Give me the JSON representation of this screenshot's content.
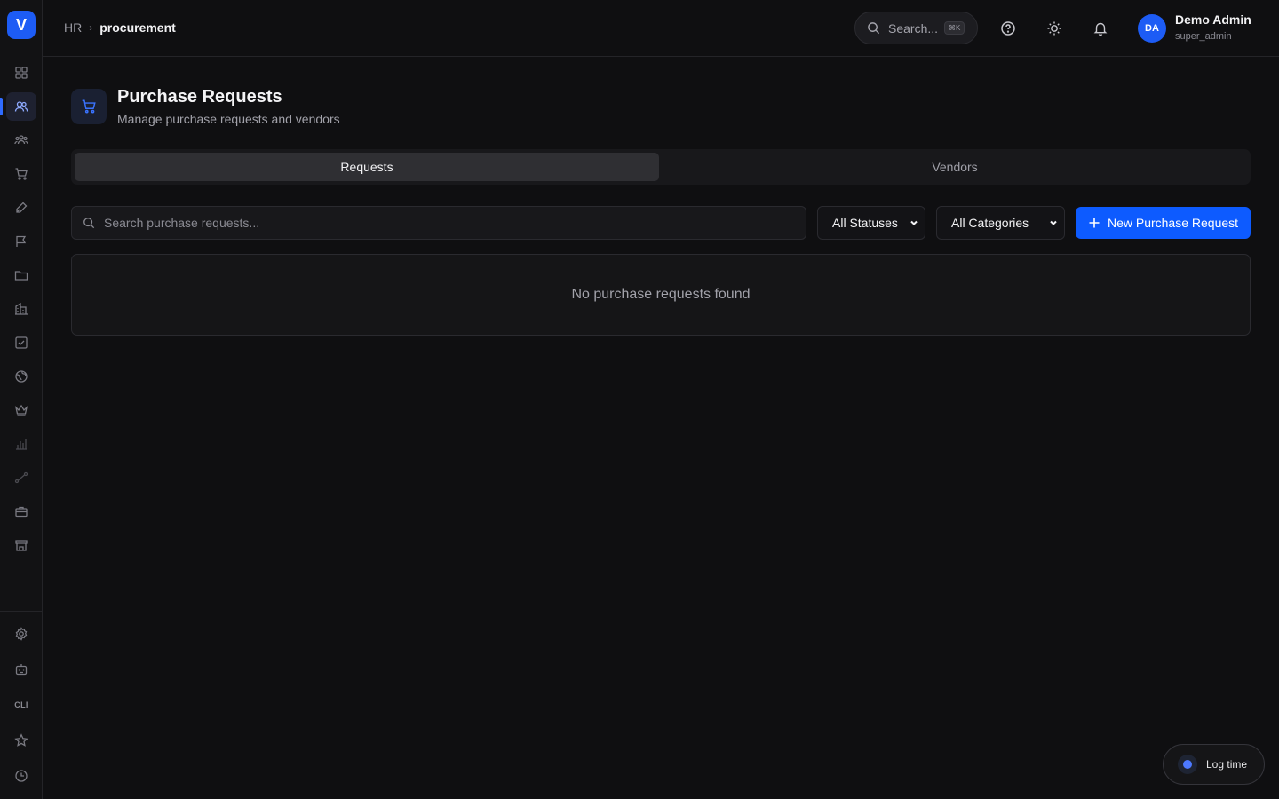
{
  "app": {
    "logo_letter": "V",
    "brand_color": "#1d5cf5"
  },
  "sidebar": {
    "items": [
      {
        "name": "dashboard",
        "icon": "grid-icon"
      },
      {
        "name": "hr",
        "icon": "users-icon",
        "active": true
      },
      {
        "name": "teams",
        "icon": "group-icon"
      },
      {
        "name": "procurement",
        "icon": "cart-icon"
      },
      {
        "name": "design",
        "icon": "pen-icon"
      },
      {
        "name": "campaigns",
        "icon": "flag-icon"
      },
      {
        "name": "files",
        "icon": "folder-icon"
      },
      {
        "name": "buildings",
        "icon": "building-icon"
      },
      {
        "name": "tasks",
        "icon": "checkbox-icon"
      },
      {
        "name": "global",
        "icon": "globe-icon"
      },
      {
        "name": "premium",
        "icon": "crown-icon"
      },
      {
        "name": "analytics",
        "icon": "bar-chart-icon"
      },
      {
        "name": "routes",
        "icon": "route-icon"
      },
      {
        "name": "jobs",
        "icon": "briefcase-icon"
      },
      {
        "name": "store",
        "icon": "store-icon"
      }
    ],
    "bottom_items": [
      {
        "name": "settings",
        "icon": "gear-icon"
      },
      {
        "name": "bot",
        "icon": "robot-icon"
      },
      {
        "name": "cli",
        "label": "CLI"
      },
      {
        "name": "favorites",
        "icon": "star-icon"
      },
      {
        "name": "history",
        "icon": "clock-icon"
      }
    ]
  },
  "header": {
    "breadcrumb": {
      "parent": "HR",
      "current": "procurement"
    },
    "search": {
      "label": "Search...",
      "shortcut": "⌘K"
    },
    "user": {
      "initials": "DA",
      "name": "Demo Admin",
      "role": "super_admin"
    }
  },
  "page": {
    "title": "Purchase Requests",
    "subtitle": "Manage purchase requests and vendors",
    "tabs": [
      {
        "label": "Requests",
        "active": true
      },
      {
        "label": "Vendors",
        "active": false
      }
    ],
    "search_placeholder": "Search purchase requests...",
    "status_filter": "All Statuses",
    "category_filter": "All Categories",
    "new_button": "New Purchase Request",
    "empty_message": "No purchase requests found"
  },
  "log_time": {
    "label": "Log time"
  }
}
